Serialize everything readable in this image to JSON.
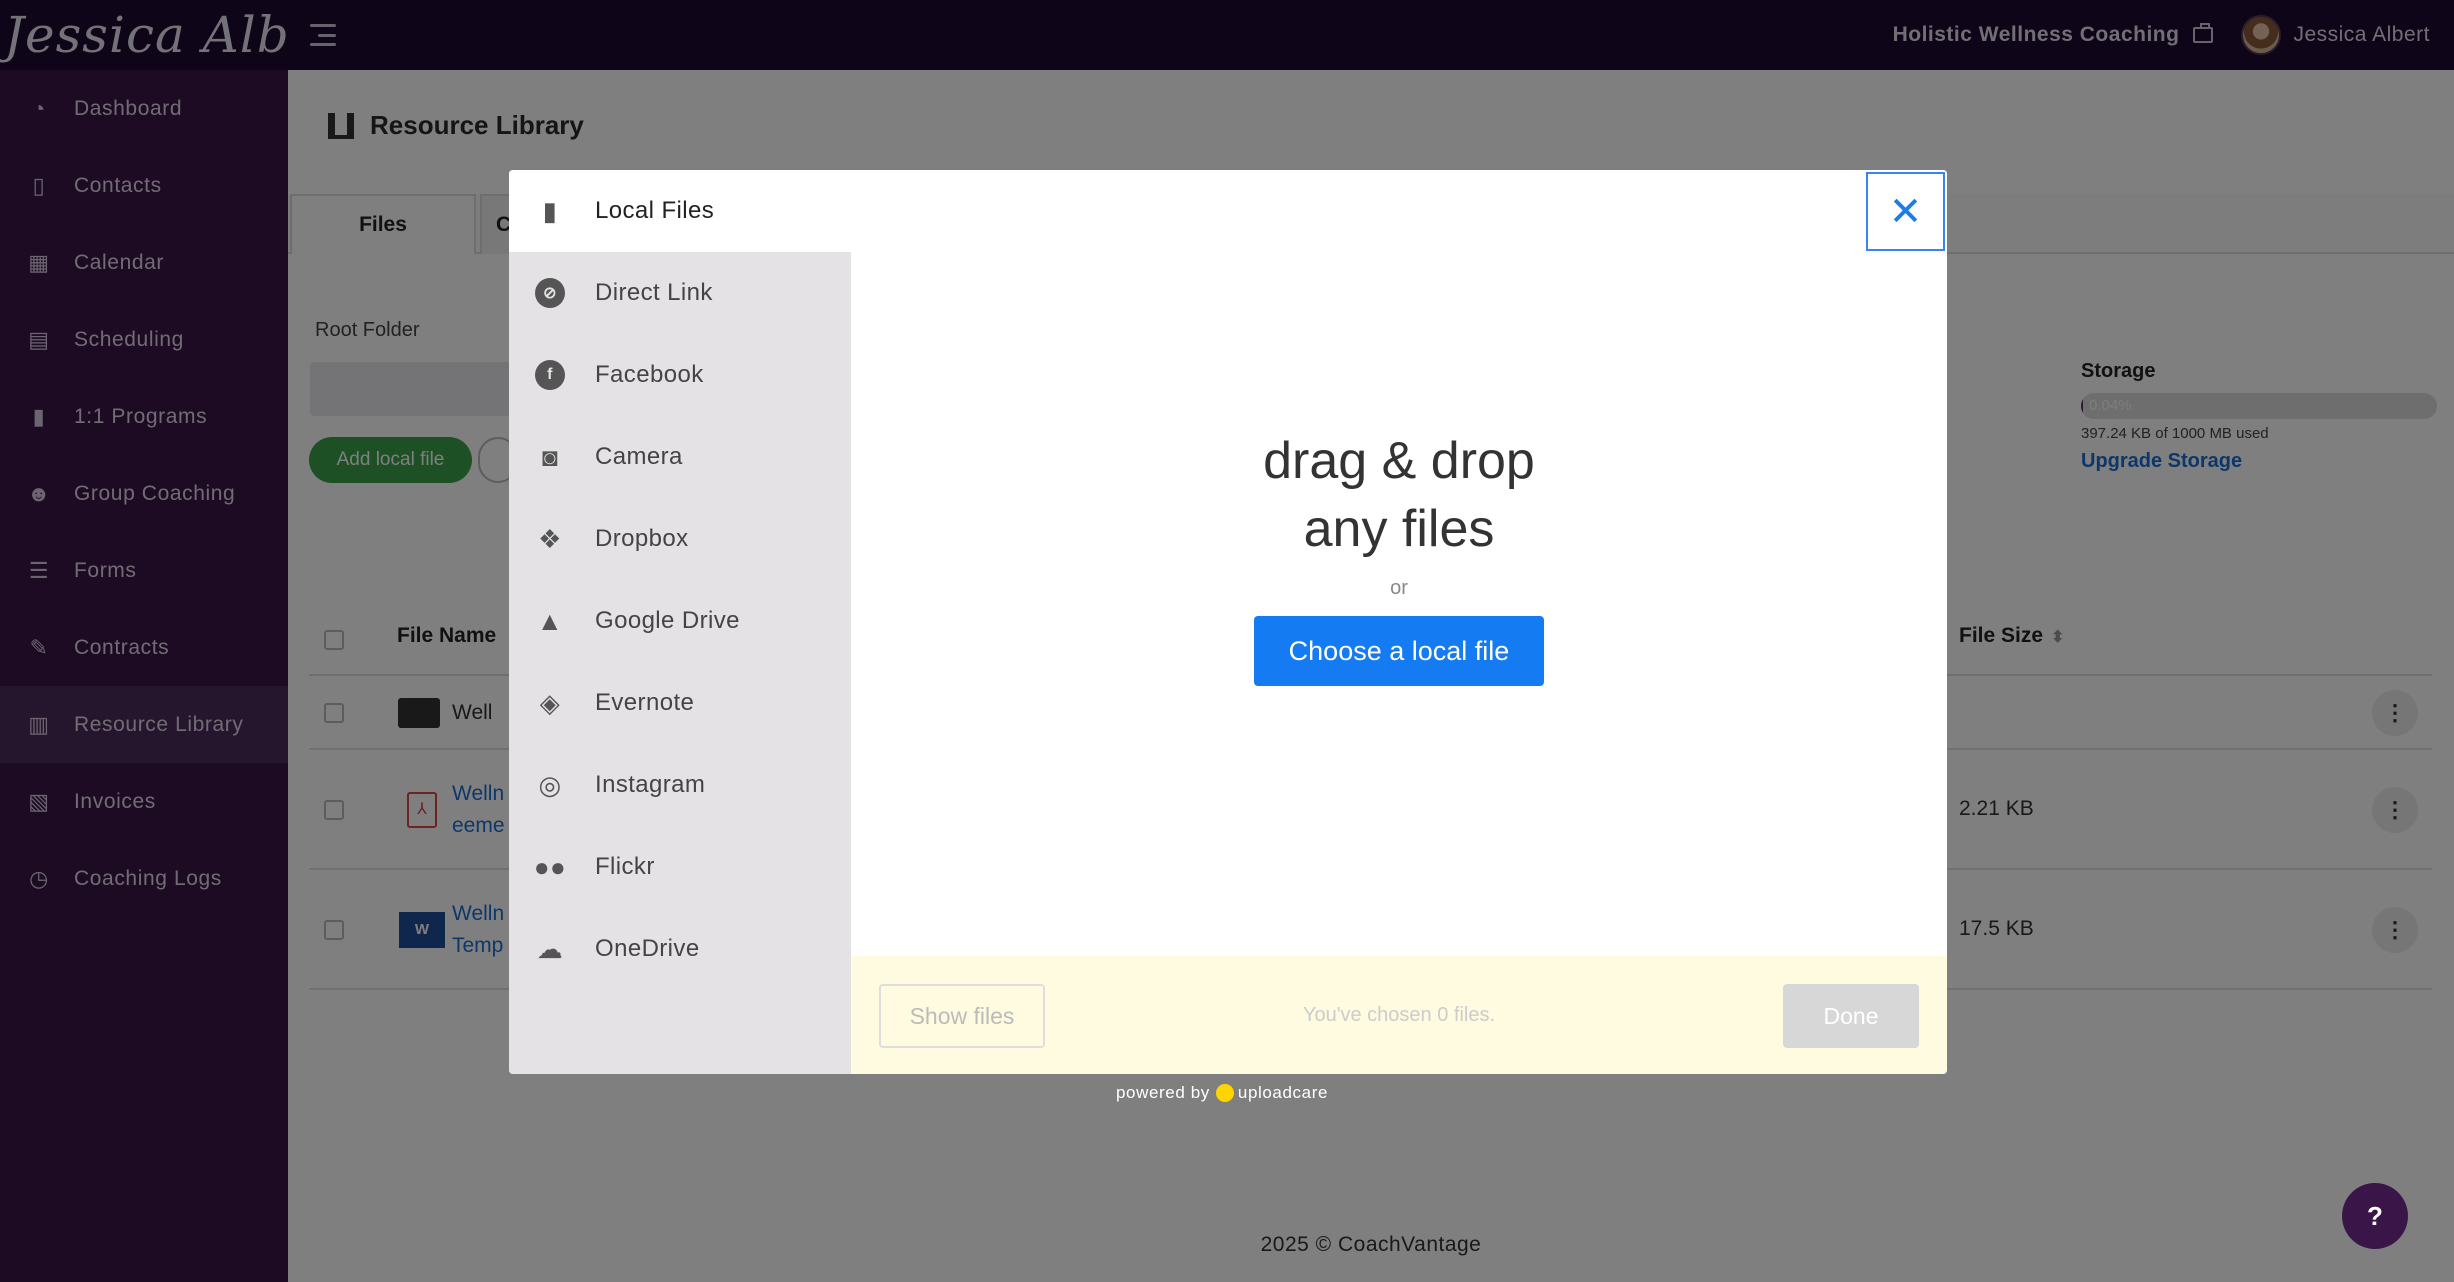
{
  "topbar": {
    "logo_text": "Jessica Albert",
    "business_name": "Holistic Wellness Coaching",
    "user_name": "Jessica Albert"
  },
  "sidebar": {
    "items": [
      {
        "label": "Dashboard",
        "icon": "dashboard-icon"
      },
      {
        "label": "Contacts",
        "icon": "contacts-icon"
      },
      {
        "label": "Calendar",
        "icon": "calendar-icon"
      },
      {
        "label": "Scheduling",
        "icon": "scheduling-icon"
      },
      {
        "label": "1:1 Programs",
        "icon": "book-icon"
      },
      {
        "label": "Group Coaching",
        "icon": "users-icon"
      },
      {
        "label": "Forms",
        "icon": "list-icon"
      },
      {
        "label": "Contracts",
        "icon": "signature-icon"
      },
      {
        "label": "Resource Library",
        "icon": "library-icon",
        "active": true
      },
      {
        "label": "Invoices",
        "icon": "invoice-icon"
      },
      {
        "label": "Coaching Logs",
        "icon": "clock-icon"
      }
    ]
  },
  "main": {
    "page_title": "Resource Library",
    "tabs": [
      {
        "label": "Files"
      },
      {
        "label": "C"
      }
    ],
    "root_folder_label": "Root Folder",
    "add_local_file_label": "Add local file",
    "storage": {
      "label": "Storage",
      "percent_text": "0.04%",
      "percent_value": 0.04,
      "used_text": "397.24 KB of 1000 MB used",
      "upgrade_label": "Upgrade Storage"
    },
    "table": {
      "headers": {
        "name": "File Name",
        "size": "File Size"
      },
      "rows": [
        {
          "type": "folder",
          "name_line1": "Well",
          "name_line2": "",
          "size": ""
        },
        {
          "type": "pdf",
          "name_line1": "Welln",
          "name_line2": "eeme",
          "size": "2.21 KB"
        },
        {
          "type": "doc",
          "name_line1": "Welln",
          "name_line2": "Temp",
          "size": "17.5 KB"
        }
      ]
    },
    "footer": "2025 © CoachVantage",
    "help_label": "?"
  },
  "dialog": {
    "sources": [
      {
        "label": "Local Files",
        "icon": "file-icon",
        "active": true
      },
      {
        "label": "Direct Link",
        "icon": "link-icon"
      },
      {
        "label": "Facebook",
        "icon": "facebook-icon"
      },
      {
        "label": "Camera",
        "icon": "camera-icon"
      },
      {
        "label": "Dropbox",
        "icon": "dropbox-icon"
      },
      {
        "label": "Google Drive",
        "icon": "google-drive-icon"
      },
      {
        "label": "Evernote",
        "icon": "evernote-icon"
      },
      {
        "label": "Instagram",
        "icon": "instagram-icon"
      },
      {
        "label": "Flickr",
        "icon": "flickr-icon"
      },
      {
        "label": "OneDrive",
        "icon": "onedrive-icon"
      }
    ],
    "close_label": "✕",
    "drop_line1": "drag & drop",
    "drop_line2": "any files",
    "or_text": "or",
    "choose_label": "Choose a local file",
    "show_files_label": "Show files",
    "chosen_text": "You've chosen 0 files.",
    "done_label": "Done",
    "powered_prefix": "powered by",
    "powered_brand": "uploadcare"
  },
  "colors": {
    "topbar": "#1c0a30",
    "sidebar": "#3a1648",
    "accent_blue": "#157bf2",
    "add_button_green": "#3aa34a"
  }
}
